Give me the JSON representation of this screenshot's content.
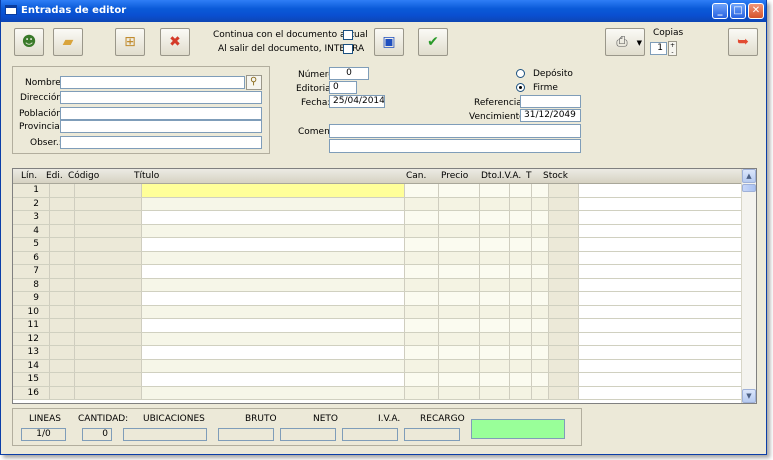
{
  "window": {
    "title": "Entradas de editor"
  },
  "toolbar": {
    "continua_label": "Continua con el documento actual",
    "integra_label": "Al salir del documento, INTEGRA",
    "copias_label": "Copias",
    "copias_value": "1"
  },
  "customer": {
    "nombre_label": "Nombre:",
    "direccion_label": "Dirección:",
    "poblacion_label": "Población:",
    "provincia_label": "Provincia:",
    "obser_label": "Obser.:",
    "nombre_value": "",
    "direccion_value": "",
    "poblacion_value": "",
    "provincia_value": "",
    "obser_value": ""
  },
  "document": {
    "numero_label": "Número:",
    "numero_value": "0",
    "editorial_label": "Editorial:",
    "editorial_value": "0",
    "fecha_label": "Fecha:",
    "fecha_value": "25/04/2014",
    "comen_label": "Comen:",
    "comen_value1": "",
    "comen_value2": "",
    "deposito_label": "Depósito",
    "firme_label": "Firme",
    "referencia_label": "Referencia:",
    "referencia_value": "",
    "vencimiento_label": "Vencimiento:",
    "vencimiento_value": "31/12/2049"
  },
  "grid": {
    "headers": [
      "Lín.",
      "Edi.",
      "Código",
      "Título",
      "Can.",
      "Precio",
      "Dto.",
      "I.V.A.",
      "T",
      "Stock"
    ],
    "rows": [
      "1",
      "2",
      "3",
      "4",
      "5",
      "6",
      "7",
      "8",
      "9",
      "10",
      "11",
      "12",
      "13",
      "14",
      "15",
      "16"
    ]
  },
  "footer": {
    "lineas_label": "LINEAS",
    "lineas_value": "1/0",
    "cantidad_label": "CANTIDAD:",
    "cantidad_value": "0",
    "ubicaciones_label": "UBICACIONES",
    "ubicaciones_value": "",
    "bruto_label": "BRUTO",
    "bruto_value": "",
    "neto_label": "NETO",
    "neto_value": "",
    "iva_label": "I.V.A.",
    "iva_value": "",
    "recargo_label": "RECARGO",
    "recargo_value": ""
  },
  "colors": {
    "titlebar": "#0a5ad8",
    "window_bg": "#ece9d8",
    "selected_cell": "#ffff99",
    "total_box": "#99ff99"
  }
}
